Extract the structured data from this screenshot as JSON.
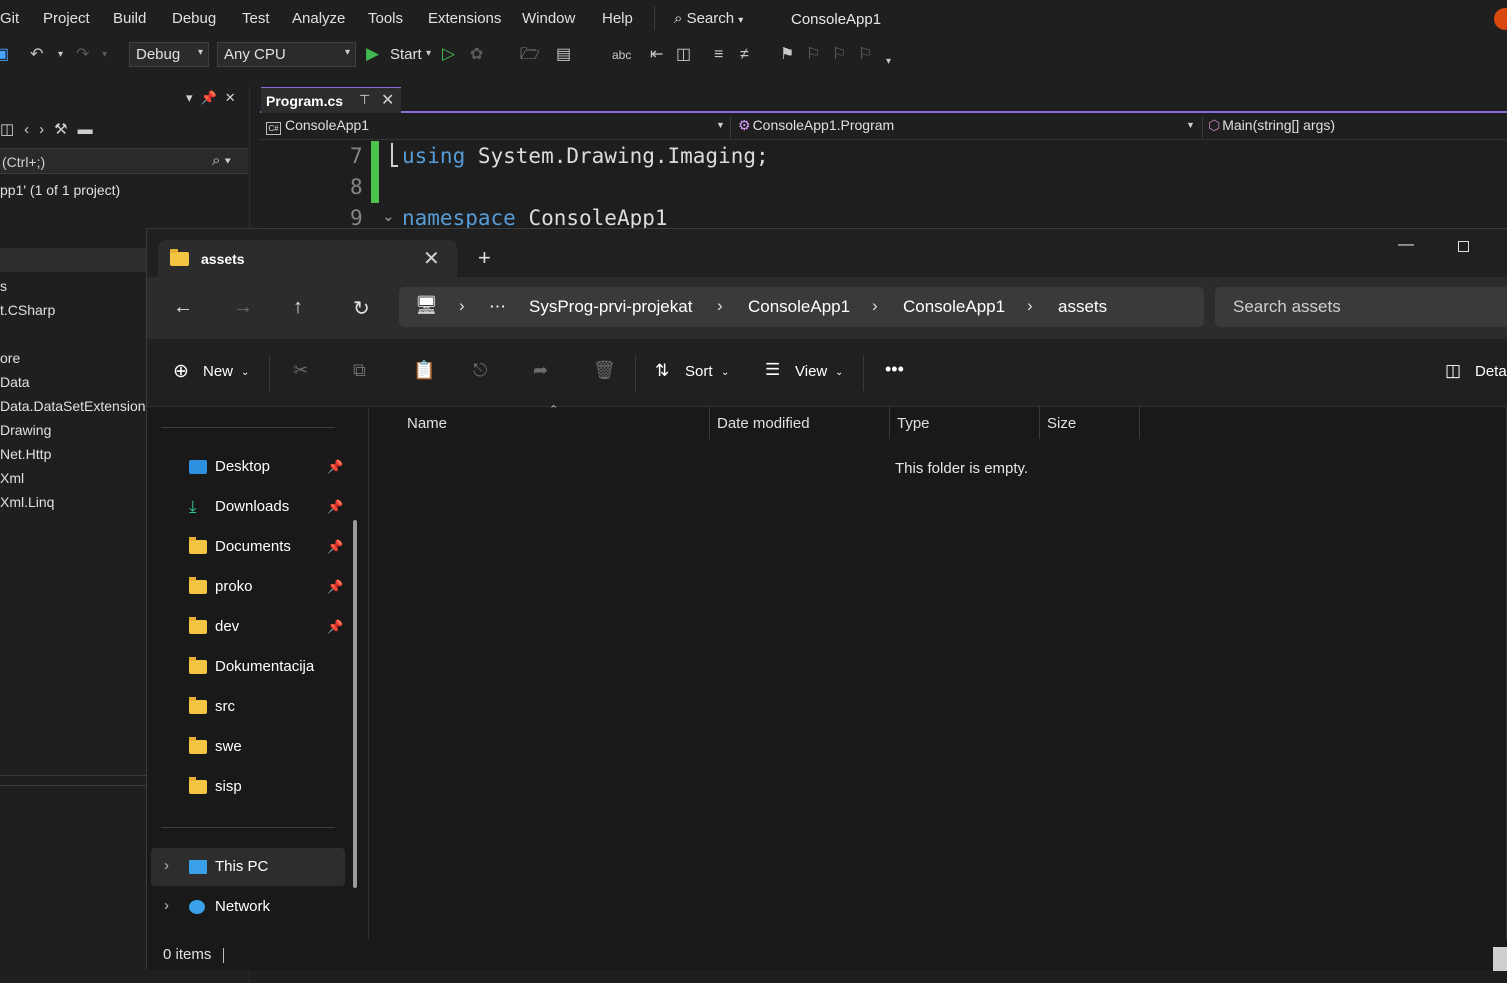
{
  "vs": {
    "menu": [
      "Git",
      "Project",
      "Build",
      "Debug",
      "Test",
      "Analyze",
      "Tools",
      "Extensions",
      "Window",
      "Help"
    ],
    "search_label": "Search",
    "app_title": "ConsoleApp1",
    "toolbar": {
      "config": "Debug",
      "platform": "Any CPU",
      "start_label": "Start"
    },
    "solution_explorer": {
      "search_placeholder": "(Ctrl+;)",
      "solution_label": "pp1' (1 of 1 project)",
      "items": [
        "s",
        "t.CSharp",
        "ore",
        "Data",
        "Data.DataSetExtensions",
        "Drawing",
        "Net.Http",
        "Xml",
        "Xml.Linq"
      ]
    },
    "editor": {
      "tab_label": "Program.cs",
      "project_combo": "ConsoleApp1",
      "class_combo": "ConsoleApp1.Program",
      "member_combo": "Main(string[] args)",
      "lines": [
        {
          "number": "7",
          "keyword": "using",
          "rest": " System.Drawing.Imaging;"
        },
        {
          "number": "8",
          "keyword": "",
          "rest": ""
        },
        {
          "number": "9",
          "keyword": "namespace",
          "rest": " ConsoleApp1"
        }
      ]
    }
  },
  "explorer": {
    "tab_label": "assets",
    "breadcrumb": [
      "SysProg-prvi-projekat",
      "ConsoleApp1",
      "ConsoleApp1",
      "assets"
    ],
    "search_placeholder": "Search assets",
    "commands": {
      "new": "New",
      "sort": "Sort",
      "view": "View",
      "details": "Deta"
    },
    "quick_access": [
      {
        "label": "Desktop",
        "pinned": true
      },
      {
        "label": "Downloads",
        "pinned": true
      },
      {
        "label": "Documents",
        "pinned": true
      },
      {
        "label": "proko",
        "pinned": true
      },
      {
        "label": "dev",
        "pinned": true
      },
      {
        "label": "Dokumentacija",
        "pinned": false
      },
      {
        "label": "src",
        "pinned": false
      },
      {
        "label": "swe",
        "pinned": false
      },
      {
        "label": "sisp",
        "pinned": false
      }
    ],
    "this_pc": "This PC",
    "network": "Network",
    "columns": [
      "Name",
      "Date modified",
      "Type",
      "Size"
    ],
    "empty_message": "This folder is empty.",
    "status": "0 items"
  }
}
